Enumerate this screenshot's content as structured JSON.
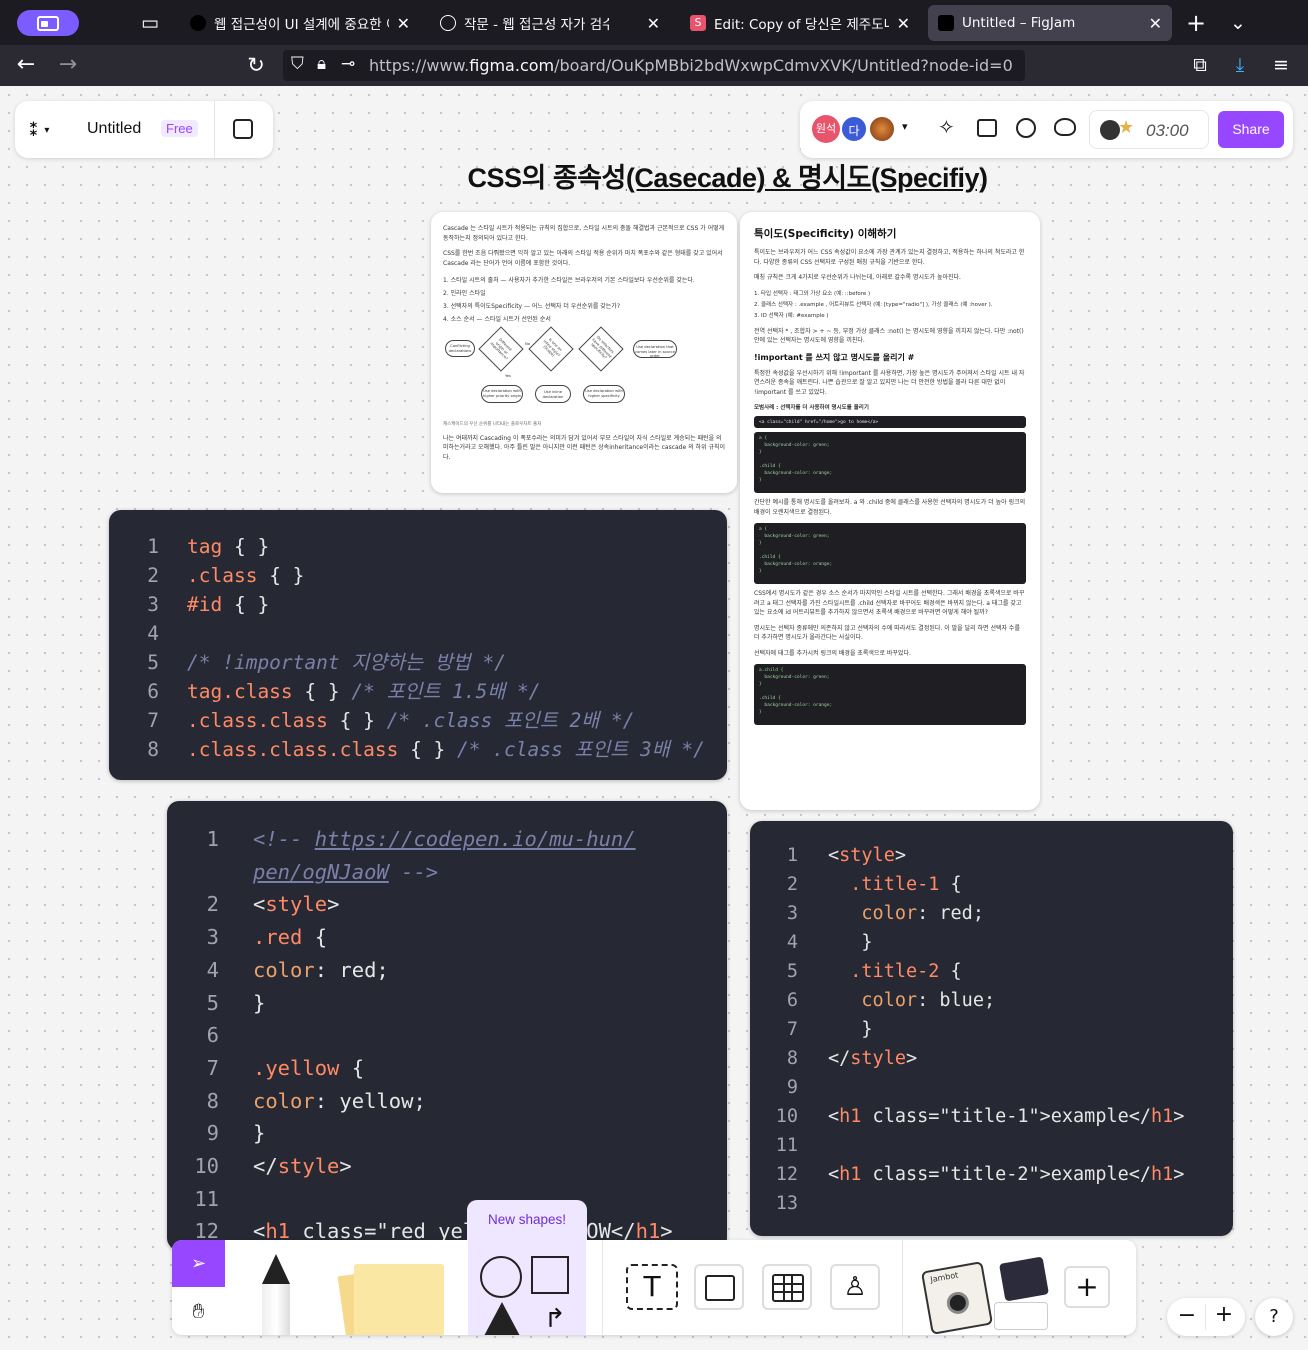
{
  "browser": {
    "tabs": [
      {
        "title": "웹 접근성이 UI 설계에 중요한 이유",
        "active": false
      },
      {
        "title": "작문 - 웹 접근성 자가 검수",
        "active": false
      },
      {
        "title": "Edit: Copy of 당신은 제주도내 지",
        "active": false
      },
      {
        "title": "Untitled – FigJam",
        "active": true
      }
    ],
    "url_prefix": "https://www.",
    "url_host": "figma.com",
    "url_path": "/board/OuKpMBbi2bdWxwpCdmvXVK/Untitled?node-id=0"
  },
  "figjam": {
    "file_name": "Untitled",
    "plan_badge": "Free",
    "avatars": [
      "원석",
      "다"
    ],
    "timer": "03:00",
    "share_label": "Share",
    "board_title_part1": "CSS의 종속성",
    "board_title_part2": "(Casecade) & 명시도",
    "board_title_part3": "(Specifiy)",
    "new_shapes_tooltip": "New shapes!",
    "zoom_minus": "−",
    "zoom_plus": "+",
    "help": "?"
  },
  "doc_left": {
    "p1": "Cascade 는 스타일 시트가 적용되는 규칙의 집합으로, 스타일 시트의 충돌 해결법과 근본적으로 CSS 가 어떻게 동작하는지 정의되어 있다고 한다.",
    "p2": "CSS를 한번 조음 다뤄봤으면 익히 알고 있는 아래의 스타일 적용 순위가 마치 폭포수와 같은 형태를 갖고 있어서 Cascade 라는 단어가 언어 이름에 포함한 것이다.",
    "list": [
      "1. 스타일 시트의 출처 — 사용자가 추가한 스타일은 브라우저의 기본 스타일보다 우선순위를 갖는다.",
      "2. 인라인 스타일",
      "3. 선택자의 특이도Specificity — 어느 선택자 더 우선순위를 갖는가?",
      "4. 소스 순서 — 스타일 시트가 선언된 순서"
    ],
    "flow": [
      "Conflicting declarations",
      "Different origin or importance?",
      "Is one an inline style? (Scope)",
      "Do selectors have different specificity?",
      "Use declaration that comes later in source order",
      "Use declaration with higher priority origin",
      "Use inline declaration",
      "Use declaration with higher specificity"
    ],
    "flow_yes": "Yes",
    "flow_no": "No",
    "caption": "캐스케이드의 우선 순위를 나타내는 플로우차트 출처",
    "p3": "나는 여태까지 Cascading 이 폭포수라는 의미가 담겨 있어서 부모 스타일이 자식 스타일로 계승되는 패턴을 의미하는거라고 오해했다. 아주 틀린 말은 아니지만 이런 패턴은 상속inheritance이라는 cascade 의 하위 규칙이다."
  },
  "doc_right": {
    "heading": "특이도(Specificity) 이해하기",
    "p1": "특이도는 브라우저가 어느 CSS 속성값이 요소에 가장 관계가 있는지 결정하고, 적용하는 하나의 척도라고 한다. 다양한 종류의 CSS 선택자로 구성된 매칭 규칙을 기반으로 한다.",
    "p2": "매칭 규칙은 크게 4가지로 우선순위가 나뉘는데, 아래로 갈수록 명시도가 높아진다.",
    "list": [
      "1. 타입 선택자 : 태그와 가상 요소 (예: ::before )",
      "2. 클래스 선택자 : .example , 어트리뷰트 선택자 (예: [type=\"radio\"] ), 가상 클래스 (예 :hover ).",
      "3. ID 선택자 (예: #example )"
    ],
    "p3": "전역 선택자 * , 조합자 > + ~ 등, 부정 가상 클래스 :not() 는 명시도에 영향을 끼치지 않는다. 다만 :not() 안에 있는 선택자는 명시도에 영향을 끼친다.",
    "subheading": "!important 를 쓰지 않고 명시도를 올리기 #",
    "p4": "특정한 속성값을 우선시하기 위해 !important 를 사용하면, 가장 높은 명시도가 주어져서 스타일 시트 내 자연스러운 종속을 깨트린다. 나쁜 습관으로 잘 알고 있지만 나는 더 안전한 방법을 몰라 다른 대안 없이 !important 를 쓰고 있었다.",
    "example_label": "모범사례 : 선택자를 더 사용하여 명시도를 올리기",
    "snippet_html": "<a class=\"child\" href=\"/home\">go to home</a>",
    "snippet_css": "a {\n  background-color: green;\n}\n\n.child {\n  background-color: orange;\n}",
    "p5": "간단한 예시를 통해 명시도를 올려보자. a 와 .child 중에 클래스를 사용한 선택자의 명시도가 더 높아 링크의 배경이 오렌지색으로 결정된다.",
    "p6": "CSS에서 명시도가 같은 경우 소스 순서가 마지막인 스타일 시트를 선택한다. 그래서 배경을 초록색으로 바꾸려고 a 태그 선택자를 가진 스타일시트를 .child 선택자로 바꾸어도 배경색은 바뀌지 않는다. a 태그를 갖고 있는 요소에 id 어트리뷰트를 추가하지 않으면서 초록색 배경으로 바꾸려면 어떻게 해야 될까?",
    "p7": "명시도는 선택자 종류에만 의존하지 않고 선택자의 수에 따라서도 결정된다. 이 말을 달리 하면 선택자 수를 더 추가하면 명시도가 올라간다는 사실이다.",
    "p8": "선택자에 태그를 추가시켜 링크의 배경을 초록색으로 바꾸었다.",
    "snippet_css2": "a.child {\n  background-color: green;\n}\n\n.child {\n  background-color: orange;\n}"
  },
  "code1": {
    "lines": [
      {
        "n": "1",
        "parts": [
          [
            "kw",
            "tag"
          ],
          [
            "pu",
            " { }"
          ]
        ]
      },
      {
        "n": "2",
        "parts": [
          [
            "kw",
            ".class"
          ],
          [
            "pu",
            " { }"
          ]
        ]
      },
      {
        "n": "3",
        "parts": [
          [
            "kw",
            "#id"
          ],
          [
            "pu",
            " { }"
          ]
        ]
      },
      {
        "n": "4",
        "parts": []
      },
      {
        "n": "5",
        "parts": [
          [
            "cm",
            "/* !important 지양하는 방법 */"
          ]
        ]
      },
      {
        "n": "6",
        "parts": [
          [
            "kw",
            "tag.class"
          ],
          [
            "pu",
            " { } "
          ],
          [
            "cm",
            "/* 포인트 1.5배 */"
          ]
        ]
      },
      {
        "n": "7",
        "parts": [
          [
            "kw",
            ".class.class"
          ],
          [
            "pu",
            " { } "
          ],
          [
            "cm",
            "/* .class 포인트 2배 */"
          ]
        ]
      },
      {
        "n": "8",
        "parts": [
          [
            "kw",
            ".class.class.class"
          ],
          [
            "pu",
            " { } "
          ],
          [
            "cm",
            "/* .class 포인트 3배 */"
          ]
        ]
      }
    ]
  },
  "code2": {
    "lines": [
      {
        "n": "1",
        "parts": [
          [
            "cm",
            "<!-- "
          ],
          [
            "link",
            "https://codepen.io/mu-hun/"
          ]
        ]
      },
      {
        "n": "",
        "parts": [
          [
            "link",
            "pen/ogNJaoW"
          ],
          [
            "cm",
            " -->"
          ]
        ]
      },
      {
        "n": "2",
        "parts": [
          [
            "pu",
            "<"
          ],
          [
            "tag",
            "style"
          ],
          [
            "pu",
            ">"
          ]
        ]
      },
      {
        "n": "3",
        "parts": [
          [
            "kw",
            ".red"
          ],
          [
            "pu",
            " {"
          ]
        ]
      },
      {
        "n": "4",
        "parts": [
          [
            "kw2",
            "color"
          ],
          [
            "pu",
            ": red;"
          ]
        ]
      },
      {
        "n": "5",
        "parts": [
          [
            "pu",
            "}"
          ]
        ]
      },
      {
        "n": "6",
        "parts": []
      },
      {
        "n": "7",
        "parts": [
          [
            "kw",
            ".yellow"
          ],
          [
            "pu",
            " {"
          ]
        ]
      },
      {
        "n": "8",
        "parts": [
          [
            "kw2",
            "color"
          ],
          [
            "pu",
            ": yellow;"
          ]
        ]
      },
      {
        "n": "9",
        "parts": [
          [
            "pu",
            "}"
          ]
        ]
      },
      {
        "n": "10",
        "parts": [
          [
            "pu",
            "</"
          ],
          [
            "tag",
            "style"
          ],
          [
            "pu",
            ">"
          ]
        ]
      },
      {
        "n": "11",
        "parts": []
      },
      {
        "n": "12",
        "parts": [
          [
            "pu",
            "<"
          ],
          [
            "tag",
            "h1"
          ],
          [
            "pu",
            " class=\"red yellow\">YELLOW</"
          ],
          [
            "tag",
            "h1"
          ],
          [
            "pu",
            ">"
          ]
        ]
      }
    ]
  },
  "code3": {
    "lines": [
      {
        "n": "1",
        "parts": [
          [
            "pu",
            "<"
          ],
          [
            "tag",
            "style"
          ],
          [
            "pu",
            ">"
          ]
        ]
      },
      {
        "n": "2",
        "parts": [
          [
            "pu",
            "  "
          ],
          [
            "kw",
            ".title-1"
          ],
          [
            "pu",
            " {"
          ]
        ]
      },
      {
        "n": "3",
        "parts": [
          [
            "pu",
            "   "
          ],
          [
            "kw2",
            "color"
          ],
          [
            "pu",
            ": red;"
          ]
        ]
      },
      {
        "n": "4",
        "parts": [
          [
            "pu",
            "   }"
          ]
        ]
      },
      {
        "n": "5",
        "parts": [
          [
            "pu",
            "  "
          ],
          [
            "kw",
            ".title-2"
          ],
          [
            "pu",
            " {"
          ]
        ]
      },
      {
        "n": "6",
        "parts": [
          [
            "pu",
            "   "
          ],
          [
            "kw2",
            "color"
          ],
          [
            "pu",
            ": blue;"
          ]
        ]
      },
      {
        "n": "7",
        "parts": [
          [
            "pu",
            "   }"
          ]
        ]
      },
      {
        "n": "8",
        "parts": [
          [
            "pu",
            "</"
          ],
          [
            "tag",
            "style"
          ],
          [
            "pu",
            ">"
          ]
        ]
      },
      {
        "n": "9",
        "parts": []
      },
      {
        "n": "10",
        "parts": [
          [
            "pu",
            "<"
          ],
          [
            "tag",
            "h1"
          ],
          [
            "pu",
            " class=\"title-1\">example</"
          ],
          [
            "tag",
            "h1"
          ],
          [
            "pu",
            ">"
          ]
        ]
      },
      {
        "n": "11",
        "parts": []
      },
      {
        "n": "12",
        "parts": [
          [
            "pu",
            "<"
          ],
          [
            "tag",
            "h1"
          ],
          [
            "pu",
            " class=\"title-2\">example</"
          ],
          [
            "tag",
            "h1"
          ],
          [
            "pu",
            ">"
          ]
        ]
      },
      {
        "n": "13",
        "parts": []
      }
    ]
  },
  "toolbar_widgets": {
    "jambot": "Jambot"
  },
  "colors": {
    "accent": "#9747ff",
    "tab_bg": "#1c1b22",
    "nav_bg": "#2b2a33",
    "code_bg": "#262833"
  }
}
